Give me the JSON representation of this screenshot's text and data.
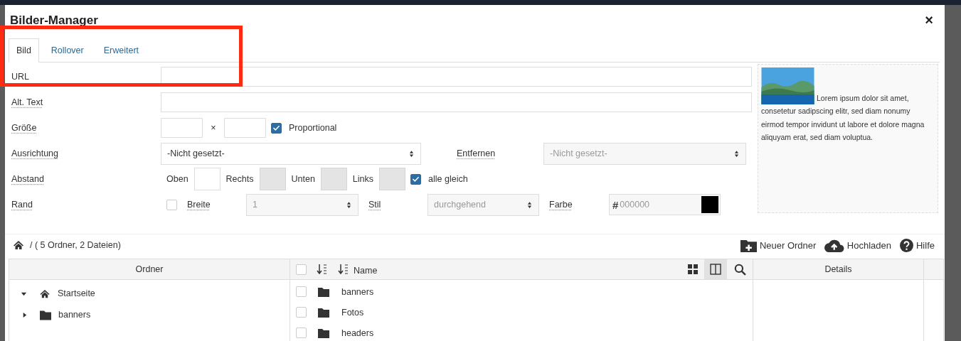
{
  "dialog": {
    "title": "Bilder-Manager",
    "close": "×"
  },
  "tabs": [
    {
      "label": "Bild",
      "selected": true
    },
    {
      "label": "Rollover",
      "selected": false
    },
    {
      "label": "Erweitert",
      "selected": false
    }
  ],
  "form": {
    "url": {
      "label": "URL"
    },
    "alt_text": {
      "label": "Alt. Text"
    },
    "size": {
      "label": "Größe",
      "separator": "×",
      "proportional": {
        "label": "Proportional",
        "checked": true
      }
    },
    "alignment": {
      "label": "Ausrichtung",
      "value": "-Nicht gesetzt-"
    },
    "remove": {
      "label": "Entfernen",
      "value": "-Nicht gesetzt-",
      "disabled": true
    },
    "spacing": {
      "label": "Abstand",
      "fields": [
        {
          "label": "Oben",
          "disabled": false
        },
        {
          "label": "Rechts",
          "disabled": true
        },
        {
          "label": "Unten",
          "disabled": true
        },
        {
          "label": "Links",
          "disabled": true
        }
      ],
      "all_equal": {
        "label": "alle gleich",
        "checked": true
      }
    },
    "border": {
      "label": "Rand",
      "checked": false,
      "width": {
        "label": "Breite",
        "value": "1"
      },
      "style": {
        "label": "Stil",
        "value": "durchgehend"
      },
      "color": {
        "label": "Farbe",
        "prefix": "#",
        "placeholder": "000000"
      }
    }
  },
  "preview": {
    "text": "Lorem ipsum dolor sit amet, consetetur sadipscing elitr, sed diam nonumy eirmod tempor invidunt ut labore et dolore magna aliquyam erat, sed diam voluptua."
  },
  "toolbar": {
    "path": "/ ( 5 Ordner, 2 Dateien)",
    "actions": [
      {
        "label": "Neuer Ordner",
        "kind": "folder"
      },
      {
        "label": "Hochladen",
        "kind": "upload"
      },
      {
        "label": "Hilfe",
        "kind": "help"
      }
    ]
  },
  "folders": {
    "heading": "Ordner",
    "tree": [
      {
        "label": "Startseite",
        "kind": "home",
        "expanded": true,
        "children": [
          {
            "label": "banners",
            "kind": "folder",
            "expanded": false
          }
        ]
      }
    ]
  },
  "files": {
    "column": "Name",
    "select_all": {
      "checked": false
    },
    "view_modes": [
      {
        "kind": "grid",
        "selected": false
      },
      {
        "kind": "columns",
        "selected": true
      }
    ],
    "rows": [
      {
        "name": "banners",
        "checked": false
      },
      {
        "name": "Fotos",
        "checked": false
      },
      {
        "name": "headers",
        "checked": false
      }
    ]
  },
  "details": {
    "heading": "Details"
  }
}
